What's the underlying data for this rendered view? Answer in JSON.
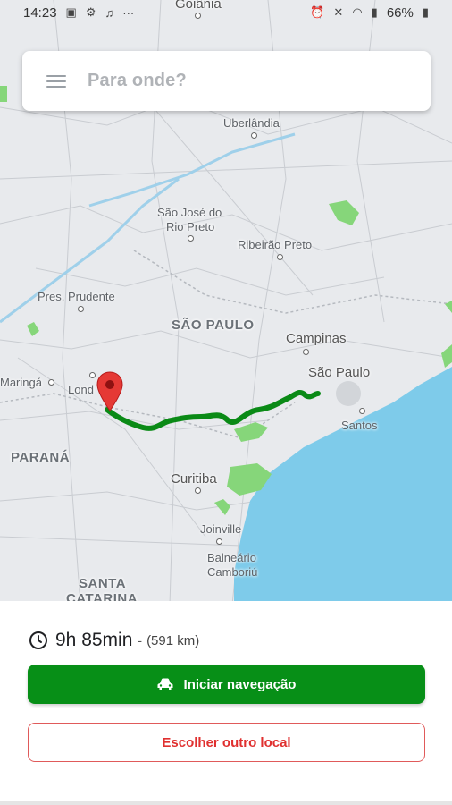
{
  "status_bar": {
    "time": "14:23",
    "battery": "66%"
  },
  "search": {
    "placeholder": "Para onde?"
  },
  "map": {
    "places": {
      "goiania": "Goiânia",
      "uberlandia": "Uberlândia",
      "sao_jose_rio_preto_1": "São José do",
      "sao_jose_rio_preto_2": "Rio Preto",
      "ribeirao_preto": "Ribeirão Preto",
      "pres_prudente": "Pres. Prudente",
      "sao_paulo_state": "SÃO PAULO",
      "campinas": "Campinas",
      "sao_paulo_city": "São Paulo",
      "maringa": "Maringá",
      "londrina": "Lond",
      "santos": "Santos",
      "parana": "PARANÁ",
      "curitiba": "Curitiba",
      "joinville": "Joinville",
      "balneario_1": "Balneário",
      "balneario_2": "Camboriú",
      "santa_catarina_1": "SANTA",
      "santa_catarina_2": "CATARINA"
    },
    "route_color": "#0a8a16",
    "water_color": "#7ecbea",
    "marker_color": "#e53935"
  },
  "route_summary": {
    "duration": "9h 85min",
    "separator": "-",
    "distance": "(591 km)"
  },
  "actions": {
    "start_label": "Iniciar navegação",
    "other_location_label": "Escolher outro local"
  }
}
